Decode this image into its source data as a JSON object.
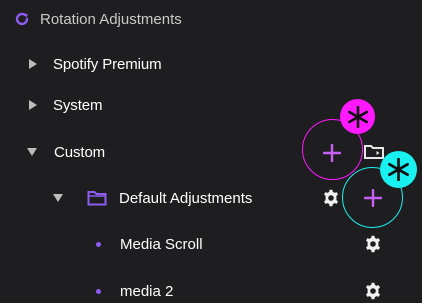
{
  "section": {
    "title": "Rotation Adjustments",
    "icon": "refresh-icon"
  },
  "tree": {
    "spotify": {
      "label": "Spotify Premium"
    },
    "system": {
      "label": "System"
    },
    "custom": {
      "label": "Custom"
    },
    "default_adjustments": {
      "label": "Default Adjustments"
    },
    "media_scroll": {
      "label": "Media Scroll"
    },
    "media_2": {
      "label": "media 2"
    }
  },
  "colors": {
    "accent": "#8e5cf0",
    "highlight_magenta": "#ff19ff",
    "highlight_cyan": "#19f0f0"
  },
  "icons": [
    "refresh-icon",
    "chevron-right-icon",
    "chevron-down-icon",
    "folder-icon",
    "folder-add-icon",
    "gear-icon",
    "plus-icon",
    "asterisk-icon"
  ]
}
